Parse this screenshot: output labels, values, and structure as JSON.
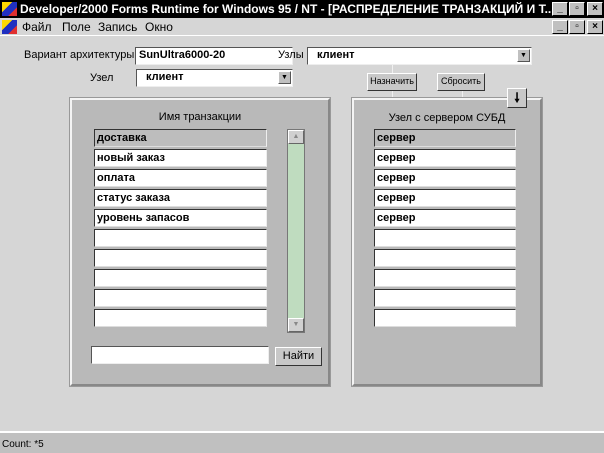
{
  "window": {
    "title": "Developer/2000 Forms Runtime for Windows 95 / NT - [РАСПРЕДЕЛЕНИЕ  ТРАНЗАКЦИЙ  И  Т..."
  },
  "menu": [
    {
      "label": "Файл"
    },
    {
      "label": "Поле"
    },
    {
      "label": "Запись"
    },
    {
      "label": "Окно"
    }
  ],
  "form": {
    "arch_label": "Вариант архитектуры",
    "arch_value": "SunUltra6000-20",
    "node_label": "Узел",
    "node_value": "клиент",
    "nodes_label": "Узлы",
    "nodes_value": "клиент",
    "assign_button": "Назначить",
    "reset_button": "Сбросить",
    "left_title": "Имя транзакции",
    "right_title": "Узел с сервером СУБД",
    "transactions": [
      "доставка",
      "новый заказ",
      "оплата",
      "статус заказа",
      "уровень запасов",
      "",
      "",
      "",
      "",
      ""
    ],
    "servers": [
      "сервер",
      "сервер",
      "сервер",
      "сервер",
      "сервер",
      "",
      "",
      "",
      "",
      ""
    ],
    "find_value": "",
    "find_button": "Найти"
  },
  "status": {
    "text": "Count: *5"
  }
}
